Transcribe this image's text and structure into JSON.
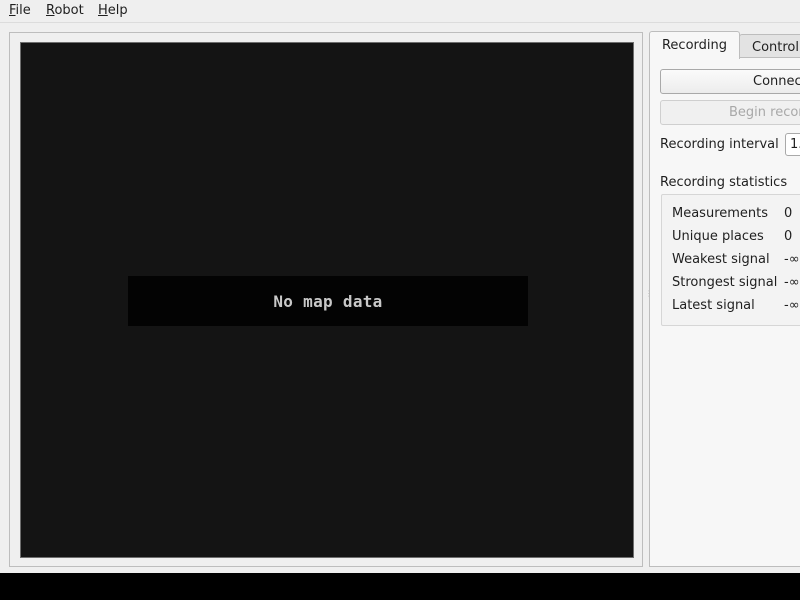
{
  "menubar": {
    "items": [
      {
        "label_mn": "F",
        "label_rest": "ile"
      },
      {
        "label_mn": "R",
        "label_rest": "obot"
      },
      {
        "label_mn": "H",
        "label_rest": "elp"
      }
    ]
  },
  "map": {
    "empty_text": "No map data"
  },
  "tabs": {
    "active": "Recording",
    "inactive": "Control"
  },
  "recording": {
    "connect_label": "Connec",
    "begin_label": "Begin recor",
    "interval_label": "Recording interval",
    "interval_value": "1.",
    "stats_title": "Recording statistics",
    "stats": [
      {
        "key": "Measurements",
        "value": "0"
      },
      {
        "key": "Unique places",
        "value": "0"
      },
      {
        "key": "Weakest signal",
        "value": "-∞"
      },
      {
        "key": "Strongest signal",
        "value": "-∞"
      },
      {
        "key": "Latest signal",
        "value": "-∞"
      }
    ]
  }
}
